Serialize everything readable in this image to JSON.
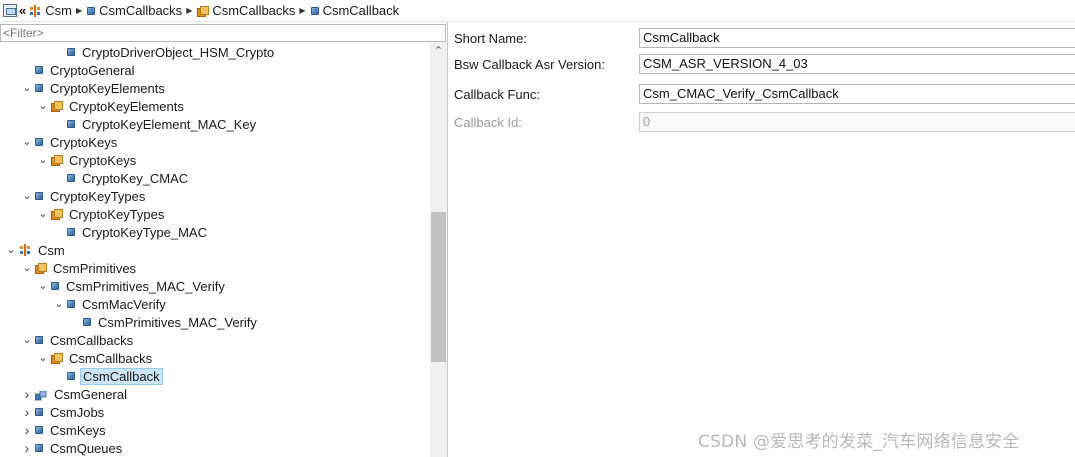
{
  "breadcrumb": {
    "items": [
      {
        "label": "Csm",
        "icon": "module-icon"
      },
      {
        "label": "CsmCallbacks",
        "icon": "container-icon"
      },
      {
        "label": "CsmCallbacks",
        "icon": "multi-container-icon"
      },
      {
        "label": "CsmCallback",
        "icon": "container-icon"
      }
    ]
  },
  "filter": {
    "placeholder": "<Filter>"
  },
  "tree": [
    {
      "label": "CryptoDriverObject_HSM_Crypto",
      "level": 3,
      "toggle": "",
      "icon": "container"
    },
    {
      "label": "CryptoGeneral",
      "level": 1,
      "toggle": "",
      "icon": "container"
    },
    {
      "label": "CryptoKeyElements",
      "level": 1,
      "toggle": "open",
      "icon": "container"
    },
    {
      "label": "CryptoKeyElements",
      "level": 2,
      "toggle": "open",
      "icon": "multi"
    },
    {
      "label": "CryptoKeyElement_MAC_Key",
      "level": 3,
      "toggle": "",
      "icon": "container"
    },
    {
      "label": "CryptoKeys",
      "level": 1,
      "toggle": "open",
      "icon": "container"
    },
    {
      "label": "CryptoKeys",
      "level": 2,
      "toggle": "open",
      "icon": "multi"
    },
    {
      "label": "CryptoKey_CMAC",
      "level": 3,
      "toggle": "",
      "icon": "container"
    },
    {
      "label": "CryptoKeyTypes",
      "level": 1,
      "toggle": "open",
      "icon": "container"
    },
    {
      "label": "CryptoKeyTypes",
      "level": 2,
      "toggle": "open",
      "icon": "multi"
    },
    {
      "label": "CryptoKeyType_MAC",
      "level": 3,
      "toggle": "",
      "icon": "container"
    },
    {
      "label": "Csm",
      "level": 0,
      "toggle": "open",
      "icon": "module"
    },
    {
      "label": "CsmPrimitives",
      "level": 1,
      "toggle": "open",
      "icon": "multi"
    },
    {
      "label": "CsmPrimitives_MAC_Verify",
      "level": 2,
      "toggle": "open",
      "icon": "container"
    },
    {
      "label": "CsmMacVerify",
      "level": 3,
      "toggle": "open",
      "icon": "container"
    },
    {
      "label": "CsmPrimitives_MAC_Verify",
      "level": 4,
      "toggle": "",
      "icon": "container"
    },
    {
      "label": "CsmCallbacks",
      "level": 1,
      "toggle": "open",
      "icon": "container"
    },
    {
      "label": "CsmCallbacks",
      "level": 2,
      "toggle": "open",
      "icon": "multi"
    },
    {
      "label": "CsmCallback",
      "level": 3,
      "toggle": "",
      "icon": "container",
      "selected": true
    },
    {
      "label": "CsmGeneral",
      "level": 1,
      "toggle": "closed",
      "icon": "param"
    },
    {
      "label": "CsmJobs",
      "level": 1,
      "toggle": "closed",
      "icon": "container"
    },
    {
      "label": "CsmKeys",
      "level": 1,
      "toggle": "closed",
      "icon": "container"
    },
    {
      "label": "CsmQueues",
      "level": 1,
      "toggle": "closed",
      "icon": "container"
    }
  ],
  "properties": [
    {
      "label": "Short Name:",
      "value": "CsmCallback",
      "disabled": false
    },
    {
      "label": "Bsw Callback Asr Version:",
      "value": "CSM_ASR_VERSION_4_03",
      "disabled": false
    },
    {
      "label": "Callback Func:",
      "value": "Csm_CMAC_Verify_CsmCallback",
      "disabled": false
    },
    {
      "label": "Callback Id:",
      "value": "0",
      "disabled": true
    }
  ],
  "watermark": "CSDN @爱思考的发菜_汽车网络信息安全"
}
